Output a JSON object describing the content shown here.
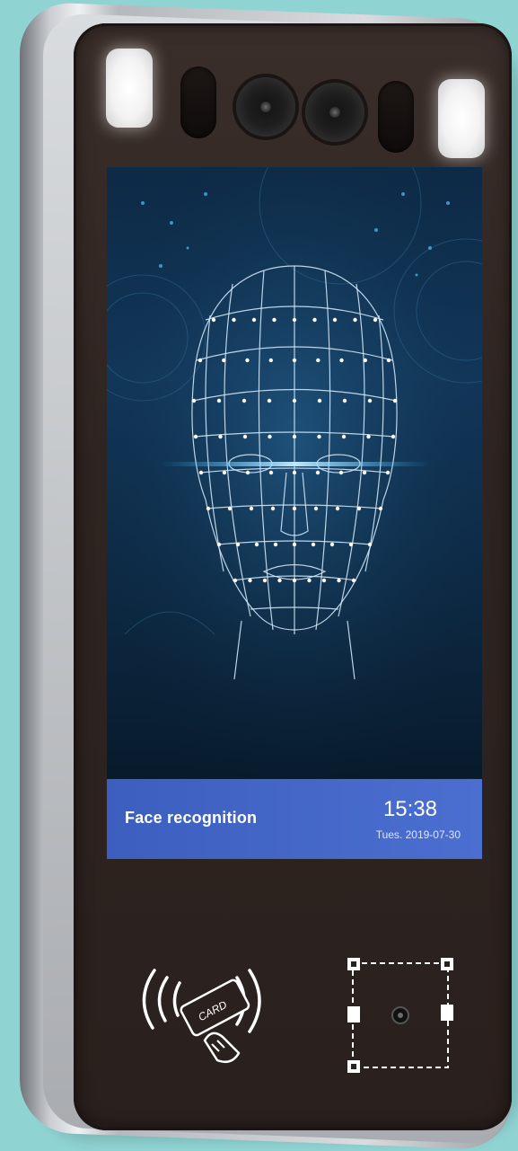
{
  "status_bar": {
    "label": "Face recognition",
    "time": "15:38",
    "date": "Tues.  2019-07-30"
  },
  "card_reader": {
    "icon": "nfc-card-icon",
    "card_text": "CARD"
  },
  "qr_scanner": {
    "icon": "qr-scanner-icon"
  },
  "colors": {
    "background": "#8fd3d2",
    "panel": "#2e2421",
    "status_bar": "#4466c8",
    "screen": "#0f3152"
  }
}
